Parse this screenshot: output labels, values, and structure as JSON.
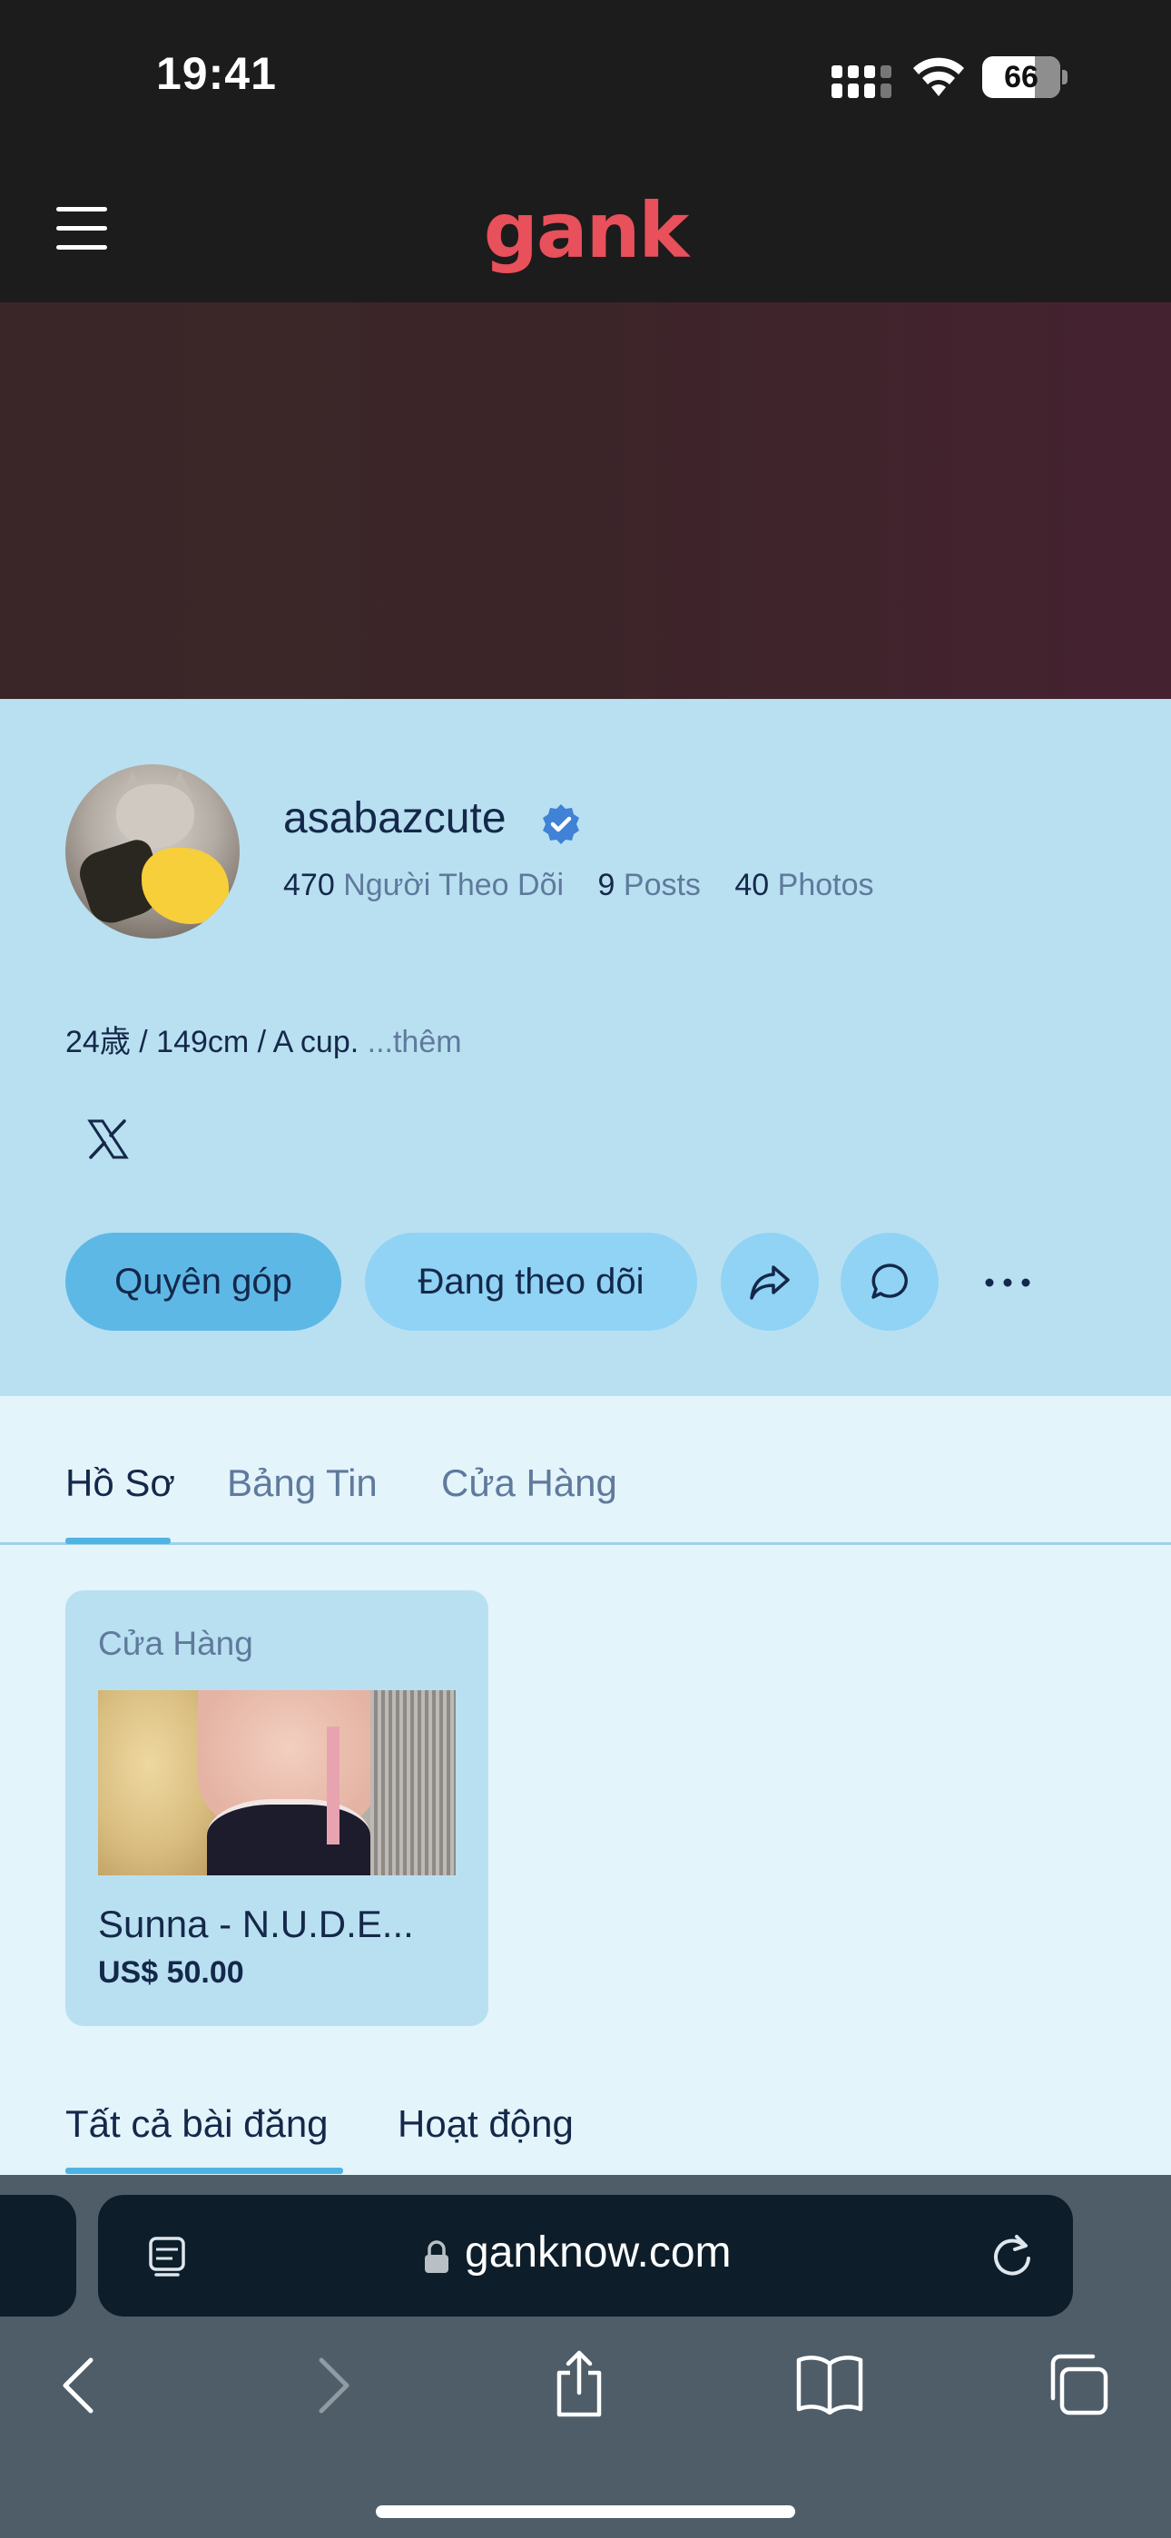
{
  "status_bar": {
    "time": "19:41",
    "battery": "66"
  },
  "header": {
    "logo": "gank"
  },
  "profile": {
    "username": "asabazcute",
    "followers_count": "470",
    "followers_label": "Người Theo Dõi",
    "posts_count": "9",
    "posts_label": "Posts",
    "photos_count": "40",
    "photos_label": "Photos",
    "bio": "24歳 / 149cm / A cup.",
    "bio_more": "...thêm",
    "social": [
      "x-icon"
    ],
    "buttons": {
      "donate": "Quyên góp",
      "following": "Đang theo dõi"
    }
  },
  "tabs": [
    {
      "label": "Hồ Sơ",
      "active": true
    },
    {
      "label": "Bảng Tin",
      "active": false
    },
    {
      "label": "Cửa Hàng",
      "active": false
    }
  ],
  "shop_card": {
    "title": "Cửa Hàng",
    "item_name": "Sunna - N.U.D.E...",
    "item_price": "US$ 50.00"
  },
  "post_tabs": [
    {
      "label": "Tất cả bài đăng",
      "active": true
    },
    {
      "label": "Hoạt động",
      "active": false
    }
  ],
  "browser": {
    "url": "ganknow.com"
  },
  "colors": {
    "brand": "#e8505b",
    "accent": "#4fb3e4",
    "profile_bg": "#b9e0f1",
    "content_bg": "#e3f4fb",
    "text_primary": "#14284a",
    "text_secondary": "#5f7a9c"
  }
}
